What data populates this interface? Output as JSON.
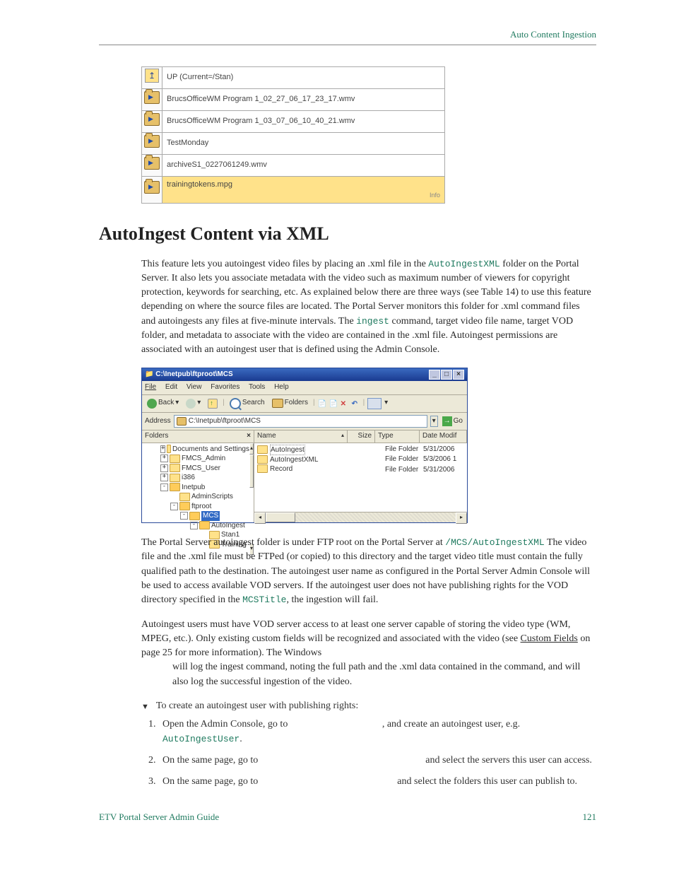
{
  "header": {
    "section": "Auto Content Ingestion"
  },
  "fileTable": {
    "rows": [
      {
        "icon": "up",
        "label": "UP (Current=/Stan)"
      },
      {
        "icon": "folder",
        "label": "BrucsOfficeWM Program 1_02_27_06_17_23_17.wmv"
      },
      {
        "icon": "folder",
        "label": "BrucsOfficeWM Program 1_03_07_06_10_40_21.wmv"
      },
      {
        "icon": "folder",
        "label": "TestMonday"
      },
      {
        "icon": "folder",
        "label": "archiveS1_0227061249.wmv"
      },
      {
        "icon": "folder",
        "label": "trainingtokens.mpg",
        "highlighted": true,
        "info": "Info"
      }
    ]
  },
  "heading": "AutoIngest Content via XML",
  "para1a": "This feature lets you autoingest video files by placing an .xml file in the ",
  "para1code": "AutoIngestXML",
  "para1b": " folder on the Portal Server. It also lets you associate metadata with the video such as maximum number of viewers for copyright protection, keywords for searching, etc. As explained below there are three ways (see Table 14) to use this feature depending on where the source files are located. The Portal Server monitors this folder for .xml command files and autoingests any files at five-minute intervals. The ",
  "para1code2": "ingest",
  "para1c": " command, target video file name, target VOD folder, and metadata to associate with the video are contained in the .xml file. Autoingest permissions are associated with an autoingest user that is defined using the Admin Console.",
  "explorer": {
    "title": "C:\\Inetpub\\ftproot\\MCS",
    "menu": [
      "File",
      "Edit",
      "View",
      "Favorites",
      "Tools",
      "Help"
    ],
    "toolbar": {
      "back": "Back",
      "search": "Search",
      "folders": "Folders"
    },
    "address_label": "Address",
    "address_value": "C:\\Inetpub\\ftproot\\MCS",
    "go": "Go",
    "folders_header": "Folders",
    "tree": [
      {
        "indent": 0,
        "toggle": "+",
        "label": "Documents and Settings"
      },
      {
        "indent": 0,
        "toggle": "+",
        "label": "FMCS_Admin"
      },
      {
        "indent": 0,
        "toggle": "+",
        "label": "FMCS_User"
      },
      {
        "indent": 0,
        "toggle": "+",
        "label": "i386"
      },
      {
        "indent": 0,
        "toggle": "-",
        "label": "Inetpub",
        "open": true
      },
      {
        "indent": 1,
        "toggle": "",
        "label": "AdminScripts"
      },
      {
        "indent": 1,
        "toggle": "-",
        "label": "ftproot",
        "open": true
      },
      {
        "indent": 2,
        "toggle": "-",
        "label": "MCS",
        "open": true,
        "selected": true
      },
      {
        "indent": 3,
        "toggle": "-",
        "label": "AutoIngest",
        "open": true
      },
      {
        "indent": 4,
        "toggle": "",
        "label": "Stan1"
      },
      {
        "indent": 4,
        "toggle": "",
        "label": "Training"
      }
    ],
    "list_headers": {
      "name": "Name",
      "size": "Size",
      "type": "Type",
      "date": "Date Modif"
    },
    "list_rows": [
      {
        "label": "AutoIngest",
        "type": "File Folder",
        "date": "5/31/2006",
        "selected": true
      },
      {
        "label": "AutoIngestXML",
        "type": "File Folder",
        "date": "5/3/2006 1"
      },
      {
        "label": "Record",
        "type": "File Folder",
        "date": "5/31/2006"
      }
    ]
  },
  "para2a": "The Portal Server autoingest folder is under FTP root on the Portal Server at ",
  "para2code1": "/MCS/AutoIngestXML",
  "para2b": " The video file and the .xml file must be FTPed (or copied) to this directory and the target video title must contain the fully qualified path to the destination. The autoingest user name as configured in the Portal Server Admin Console will be used to access available VOD servers. If the autoingest user does not have publishing rights for the VOD directory specified in the ",
  "para2code2": "MCSTitle",
  "para2c": ", the ingestion will fail.",
  "para3a": "Autoingest users must have VOD server access to at least one server capable of storing the video type (WM, MPEG, etc.). Only existing custom fields will be recognized and associated with the video (see ",
  "para3link": "Custom Fields",
  "para3b": " on page 25 for more information). The Windows ",
  "para3c": " will log the ingest command, noting the full path and the .xml data contained in the command, and will also log the successful ingestion of the video.",
  "proc_title": "To create an autoingest user with publishing rights:",
  "steps": {
    "s1a": "Open the Admin Console, go to ",
    "s1b": ", and create an autoingest user, e.g. ",
    "s1code": "AutoIngestUser",
    "s2a": "On the same page, go to ",
    "s2b": " and select the servers this user can access.",
    "s3a": "On the same page, go to ",
    "s3b": " and select the folders this user can publish to."
  },
  "footer": {
    "left": "ETV Portal Server Admin Guide",
    "right": "121"
  }
}
